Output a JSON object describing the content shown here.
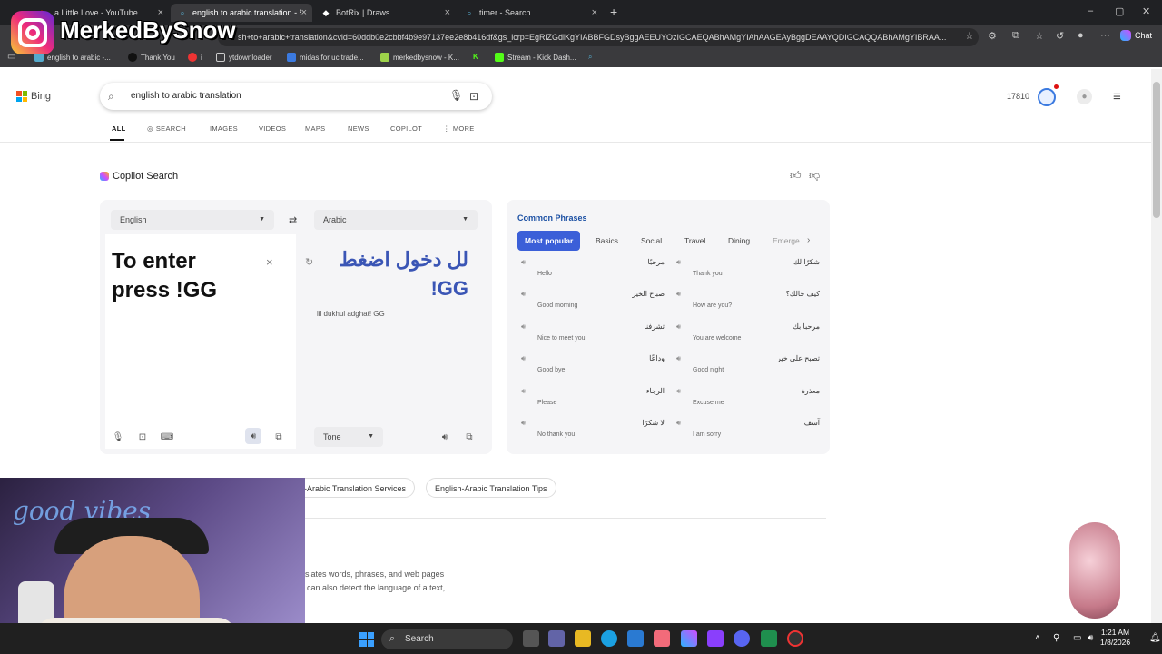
{
  "browser": {
    "tabs": [
      {
        "label": "a Little Love - YouTube"
      },
      {
        "label": "english to arabic translation - Sear"
      },
      {
        "label": "BotRix | Draws"
      },
      {
        "label": "timer - Search"
      }
    ],
    "url": "sh+to+arabic+translation&cvid=60ddb0e2cbbf4b9e97137ee2e8b416df&gs_lcrp=EgRlZGdlKgYIABBFGDsyBggAEEUYOzIGCAEQABhAMgYIAhAAGEAyBggDEAAYQDIGCAQQABhAMgYIBRAA...",
    "bookmarks": [
      {
        "label": "english to arabic -..."
      },
      {
        "label": "Thank You"
      },
      {
        "label": "i"
      },
      {
        "label": "ytdownloader"
      },
      {
        "label": "midas for uc trade..."
      },
      {
        "label": "merkedbysnow - K..."
      },
      {
        "label": "Stream - Kick Dash..."
      }
    ],
    "chat_label": "Chat"
  },
  "bing": {
    "logo": "Bing",
    "query": "english to arabic translation",
    "points": "17810",
    "nav": [
      "ALL",
      "SEARCH",
      "IMAGES",
      "VIDEOS",
      "MAPS",
      "NEWS",
      "COPILOT",
      "MORE"
    ]
  },
  "copilot": {
    "title": "Copilot Search"
  },
  "translator": {
    "source_lang": "English",
    "target_lang": "Arabic",
    "source_text": "To enter press !GG",
    "target_text": "لل دخول اضغط GG!",
    "transliteration": "lil dukhul adghat! GG",
    "tone_label": "Tone"
  },
  "phrases": {
    "title": "Common Phrases",
    "tabs": [
      "Most popular",
      "Basics",
      "Social",
      "Travel",
      "Dining",
      "Emerge"
    ],
    "items": [
      {
        "ar": "مرحبًا",
        "en": "Hello"
      },
      {
        "ar": "شكرًا لك",
        "en": "Thank you"
      },
      {
        "ar": "صباح الخير",
        "en": "Good morning"
      },
      {
        "ar": "كيف حالك؟",
        "en": "How are you?"
      },
      {
        "ar": "تشرفنا",
        "en": "Nice to meet you"
      },
      {
        "ar": "مرحبا بك",
        "en": "You are welcome"
      },
      {
        "ar": "وداعًا",
        "en": "Good bye"
      },
      {
        "ar": "تصبح على خير",
        "en": "Good night"
      },
      {
        "ar": "الرجاء",
        "en": "Please"
      },
      {
        "ar": "معذرة",
        "en": "Excuse me"
      },
      {
        "ar": "لا شكرًا",
        "en": "No thank you"
      },
      {
        "ar": "آسف",
        "en": "I am sorry"
      }
    ]
  },
  "related": {
    "chips": [
      "-Arabic Translation Services",
      "English-Arabic Translation Tips"
    ]
  },
  "description": {
    "line1": "slates words, phrases, and web pages",
    "line2": "can also detect the language of a text, ..."
  },
  "overlay": {
    "handle": "MerkedBySnow",
    "cam_text": "good vibes"
  },
  "taskbar": {
    "search_label": "Search",
    "time": "1:21 AM",
    "date": "1/8/2026"
  },
  "colors": {
    "accent": "#3b5fd8",
    "arabic_text": "#3a55b5",
    "phrase_title": "#1a4fa3"
  }
}
